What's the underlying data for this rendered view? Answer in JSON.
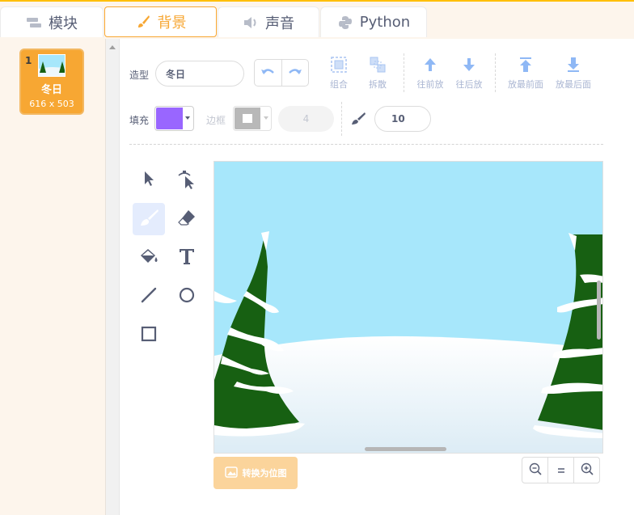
{
  "tabs": [
    {
      "label": "模块",
      "icon": "blocks-icon",
      "active": false
    },
    {
      "label": "背景",
      "icon": "paintbrush-icon",
      "active": true
    },
    {
      "label": "声音",
      "icon": "speaker-icon",
      "active": false
    },
    {
      "label": "Python",
      "icon": "python-icon",
      "active": false
    }
  ],
  "backdrops": [
    {
      "index": "1",
      "name": "冬日",
      "size": "616 x 503",
      "selected": true
    }
  ],
  "editor": {
    "costume_label": "造型",
    "costume_name": "冬日",
    "fill_label": "填充",
    "fill_color": "#9966ff",
    "outline_label": "边框",
    "outline_color": "#b8b8b8",
    "outline_width": "4",
    "brush_size": "10",
    "actions": {
      "group": "组合",
      "ungroup": "拆散",
      "forward": "往前放",
      "backward": "往后放",
      "front": "放最前面",
      "back": "放最后面"
    },
    "convert_label": "转换为位图"
  },
  "tools": [
    "select-tool",
    "reshape-tool",
    "brush-tool",
    "eraser-tool",
    "fill-tool",
    "text-tool",
    "line-tool",
    "circle-tool",
    "rectangle-tool"
  ],
  "selected_tool": "brush-tool",
  "colors": {
    "accent": "#f7a733",
    "sky": "#a7e7fb",
    "tree": "#176012",
    "icon": "#575e75"
  }
}
